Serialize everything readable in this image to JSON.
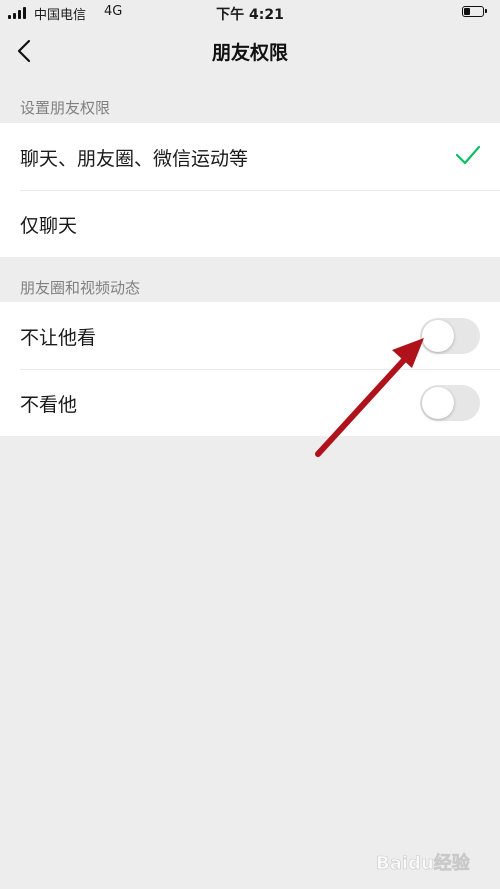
{
  "status_bar": {
    "carrier": "中国电信",
    "network": "4G",
    "time": "下午 4:21",
    "battery_level": 0.35
  },
  "nav": {
    "title": "朋友权限",
    "back_icon": "chevron-left-icon"
  },
  "sections": {
    "permissions": {
      "header": "设置朋友权限",
      "options": [
        {
          "label": "聊天、朋友圈、微信运动等",
          "selected": true
        },
        {
          "label": "仅聊天",
          "selected": false
        }
      ]
    },
    "moments": {
      "header": "朋友圈和视频动态",
      "toggles": [
        {
          "label": "不让他看",
          "on": false
        },
        {
          "label": "不看他",
          "on": false
        }
      ]
    }
  },
  "colors": {
    "background": "#ededed",
    "check": "#07c160",
    "annotation_arrow": "#b0121b",
    "switch_off": "#e6e6e6"
  },
  "watermark": {
    "text": "Baidu经验"
  }
}
